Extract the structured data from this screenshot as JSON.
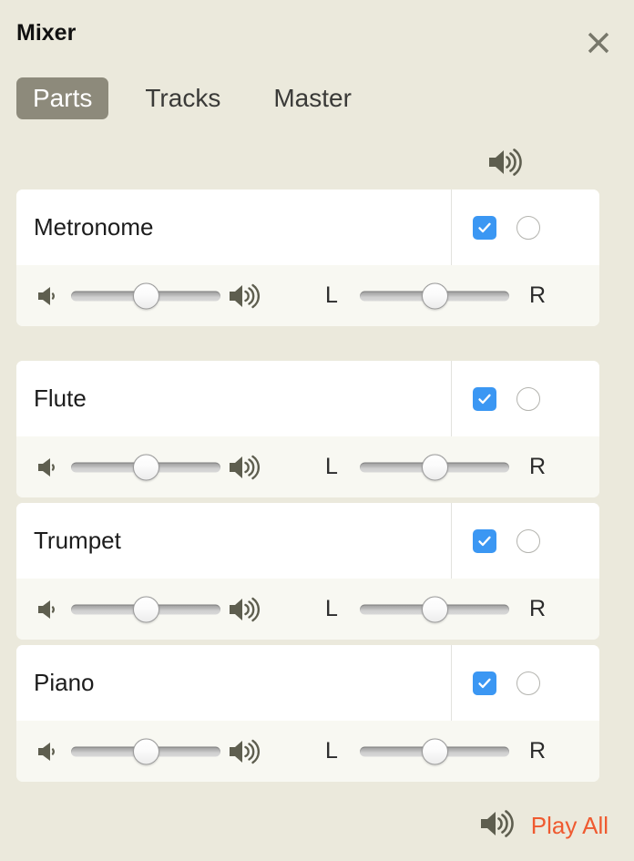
{
  "window": {
    "title": "Mixer",
    "close_icon": "close-x-icon"
  },
  "tabs": [
    {
      "label": "Parts",
      "active": true
    },
    {
      "label": "Tracks",
      "active": false
    },
    {
      "label": "Master",
      "active": false
    }
  ],
  "global_controls": {
    "speaker_icon": "speaker-waves-icon"
  },
  "columns": {
    "pan_left_label": "L",
    "pan_right_label": "R"
  },
  "parts": [
    {
      "name": "Metronome",
      "enabled": true,
      "solo": false,
      "volume": 50,
      "pan": 50,
      "gap_after": true
    },
    {
      "name": "Flute",
      "enabled": true,
      "solo": false,
      "volume": 50,
      "pan": 50,
      "gap_after": false
    },
    {
      "name": "Trumpet",
      "enabled": true,
      "solo": false,
      "volume": 50,
      "pan": 50,
      "gap_after": false
    },
    {
      "name": "Piano",
      "enabled": true,
      "solo": false,
      "volume": 50,
      "pan": 50,
      "gap_after": false
    }
  ],
  "footer": {
    "speaker_icon": "speaker-waves-icon",
    "play_all_label": "Play All"
  },
  "colors": {
    "page_background": "#ebe9dc",
    "card_background": "#ffffff",
    "slider_row_background": "#f8f8f2",
    "active_tab_background": "#8d8a7b",
    "checkbox_checked": "#3b97f3",
    "play_all_text": "#ef5a30",
    "icon_color": "#5e5e4f"
  }
}
